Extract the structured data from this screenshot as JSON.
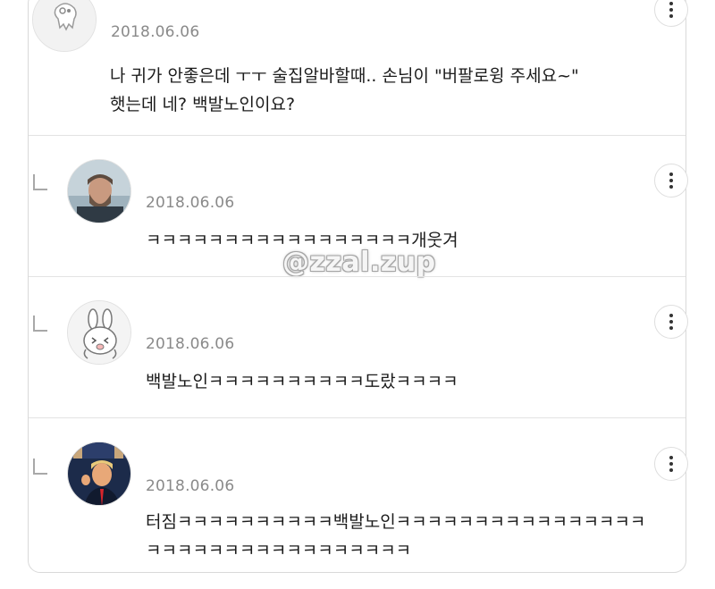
{
  "comments": [
    {
      "date": "2018.06.06",
      "text": "나 귀가 안좋은데 ㅜㅜ 술집알바할때.. 손님이 \"버팔로윙 주세요~\"\n햇는데 네? 백발노인이요?",
      "avatar": "ghost-character-avatar",
      "is_reply": false
    },
    {
      "date": "2018.06.06",
      "text": "ㅋㅋㅋㅋㅋㅋㅋㅋㅋㅋㅋㅋㅋㅋㅋㅋㅋ개웃겨",
      "avatar": "bearded-man-photo-avatar",
      "is_reply": true
    },
    {
      "date": "2018.06.06",
      "text": "백발노인ㅋㅋㅋㅋㅋㅋㅋㅋㅋㅋ도랐ㅋㅋㅋㅋ",
      "avatar": "rabbit-cartoon-avatar",
      "is_reply": true
    },
    {
      "date": "2018.06.06",
      "text": "터짐ㅋㅋㅋㅋㅋㅋㅋㅋㅋㅋ백발노인ㅋㅋㅋㅋㅋㅋㅋㅋㅋㅋㅋㅋㅋㅋㅋㅋ\nㅋㅋㅋㅋㅋㅋㅋㅋㅋㅋㅋㅋㅋㅋㅋㅋㅋ",
      "avatar": "man-in-suit-photo-avatar",
      "is_reply": true
    }
  ],
  "watermark": "@zzal.zup",
  "icons": {
    "more": "more-vertical-icon",
    "reply": "reply-arrow-icon"
  },
  "colors": {
    "date": "#8a8a8a",
    "border": "#d9d9d9",
    "text": "#1b1b1b"
  }
}
